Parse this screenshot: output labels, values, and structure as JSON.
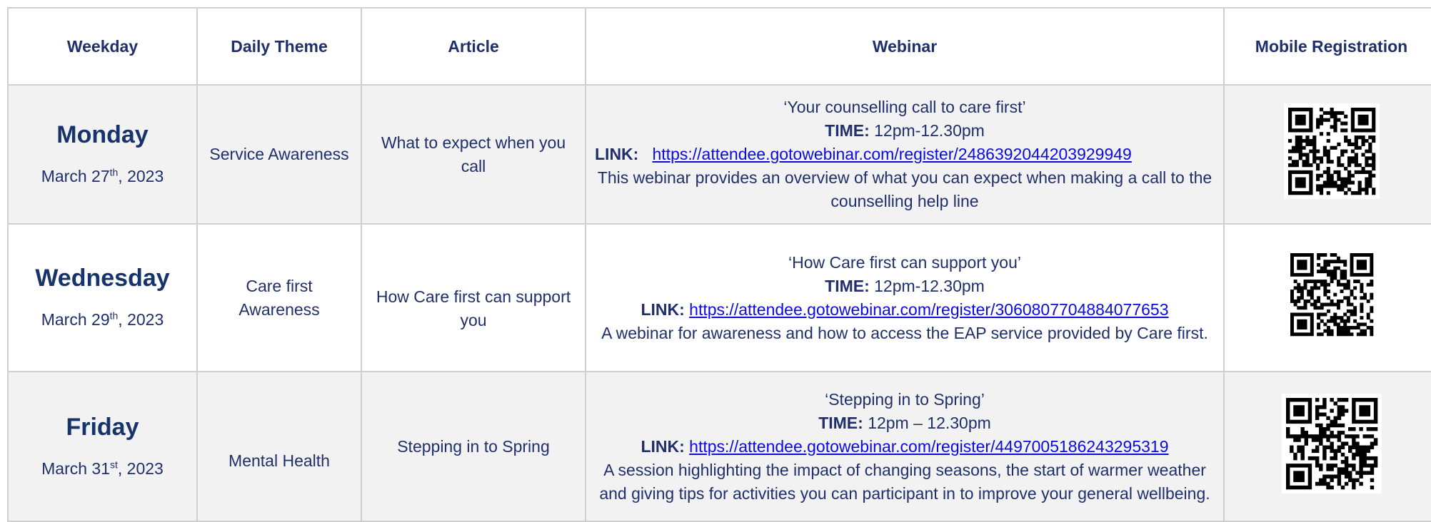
{
  "headers": {
    "weekday": "Weekday",
    "theme": "Daily Theme",
    "article": "Article",
    "webinar": "Webinar",
    "registration": "Mobile Registration"
  },
  "labels": {
    "time": "TIME:",
    "link": "LINK:"
  },
  "rows": [
    {
      "day": "Monday",
      "date_prefix": "March 27",
      "date_sup": "th",
      "date_suffix": ", 2023",
      "theme": "Service Awareness",
      "article": "What to expect when you call",
      "webinar_title": "‘Your counselling call to care first’",
      "time": "12pm-12.30pm",
      "link": "https://attendee.gotowebinar.com/register/2486392044203929949",
      "description": "This webinar provides an overview of what you can expect when making a call to the counselling help line"
    },
    {
      "day": "Wednesday",
      "date_prefix": "March 29",
      "date_sup": "th",
      "date_suffix": ", 2023",
      "theme": "Care first Awareness",
      "article": "How Care first can support you",
      "webinar_title": "‘How Care first can support you’",
      "time": "12pm-12.30pm",
      "link": "https://attendee.gotowebinar.com/register/3060807704884077653",
      "description": "A webinar for awareness and how to access the EAP service provided by Care first."
    },
    {
      "day": "Friday",
      "date_prefix": "March 31",
      "date_sup": "st",
      "date_suffix": ", 2023",
      "theme": "Mental Health",
      "article": "Stepping in to Spring",
      "webinar_title": "‘Stepping in to Spring’",
      "time": "12pm – 12.30pm",
      "link": "https://attendee.gotowebinar.com/register/4497005186243295319",
      "description": "A session highlighting the impact of changing seasons, the start of warmer weather and giving tips for activities you can participant in to improve your general wellbeing."
    }
  ]
}
